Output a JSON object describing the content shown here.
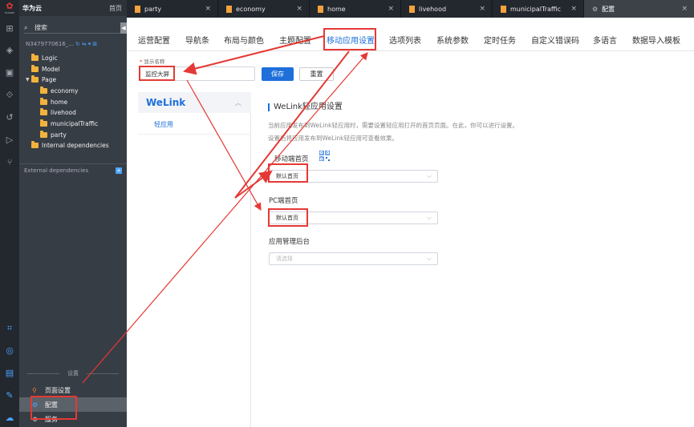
{
  "rail": {
    "logo_text": "HUAWEI",
    "icons": [
      "sitemap-icon",
      "layers-icon",
      "package-icon",
      "hub-icon",
      "history-icon",
      "play-icon",
      "branch-icon",
      "scan-icon",
      "target-icon",
      "terminal-icon",
      "wrench-icon",
      "cloud-upload-icon"
    ]
  },
  "tree": {
    "brand": "华为云",
    "home": "首页",
    "search_placeholder": "搜索",
    "project_id": "N3479770616_...",
    "nodes": [
      {
        "label": "Logic",
        "level": 1,
        "expanded": false
      },
      {
        "label": "Model",
        "level": 1,
        "expanded": false
      },
      {
        "label": "Page",
        "level": 1,
        "expanded": true
      },
      {
        "label": "economy",
        "level": 2
      },
      {
        "label": "home",
        "level": 2
      },
      {
        "label": "livehood",
        "level": 2
      },
      {
        "label": "municipalTraffic",
        "level": 2
      },
      {
        "label": "party",
        "level": 2
      },
      {
        "label": "Internal dependencies",
        "level": 1,
        "expanded": false
      }
    ],
    "external": "External dependencies",
    "bottom_section": "设置",
    "bottom_items": [
      {
        "label": "页面设置",
        "icon": "pin-icon",
        "active": false
      },
      {
        "label": "配置",
        "icon": "gear-icon",
        "active": true
      },
      {
        "label": "服务",
        "icon": "service-icon",
        "active": false
      }
    ]
  },
  "tabs": [
    {
      "label": "party",
      "active": false
    },
    {
      "label": "economy",
      "active": false
    },
    {
      "label": "home",
      "active": false
    },
    {
      "label": "livehood",
      "active": false
    },
    {
      "label": "municipalTraffic",
      "active": false
    },
    {
      "label": "配置",
      "active": true
    }
  ],
  "subnav": [
    "运营配置",
    "导航条",
    "布局与颜色",
    "主题配置",
    "移动应用设置",
    "选项列表",
    "系统参数",
    "定时任务",
    "自定义错误码",
    "多语言",
    "数据导入模板"
  ],
  "subnav_active": "移动应用设置",
  "form": {
    "display_name_label": "显示名称",
    "required_mark": "*",
    "display_name_value": "监控大屏",
    "save_label": "保存",
    "reset_label": "重置"
  },
  "welink": {
    "title": "WeLink",
    "sub_item": "轻应用"
  },
  "section": {
    "title": "WeLink轻应用设置",
    "desc1": "当前应用发布到WeLink轻应用时，需要设置轻应用打开的首页页面。在此，你可以进行设置。",
    "desc2": "设置后将应用发布到WeLink轻应用可查看效果。",
    "mobile_label": "移动端首页",
    "mobile_value": "默认首页",
    "pc_label": "PC端首页",
    "pc_value": "默认首页",
    "admin_label": "应用管理后台",
    "admin_placeholder": "请选择"
  },
  "colors": {
    "accent": "#1e6fd9",
    "annotation": "#e53935",
    "rail_bg": "#23272e",
    "tree_bg": "#373d45"
  }
}
